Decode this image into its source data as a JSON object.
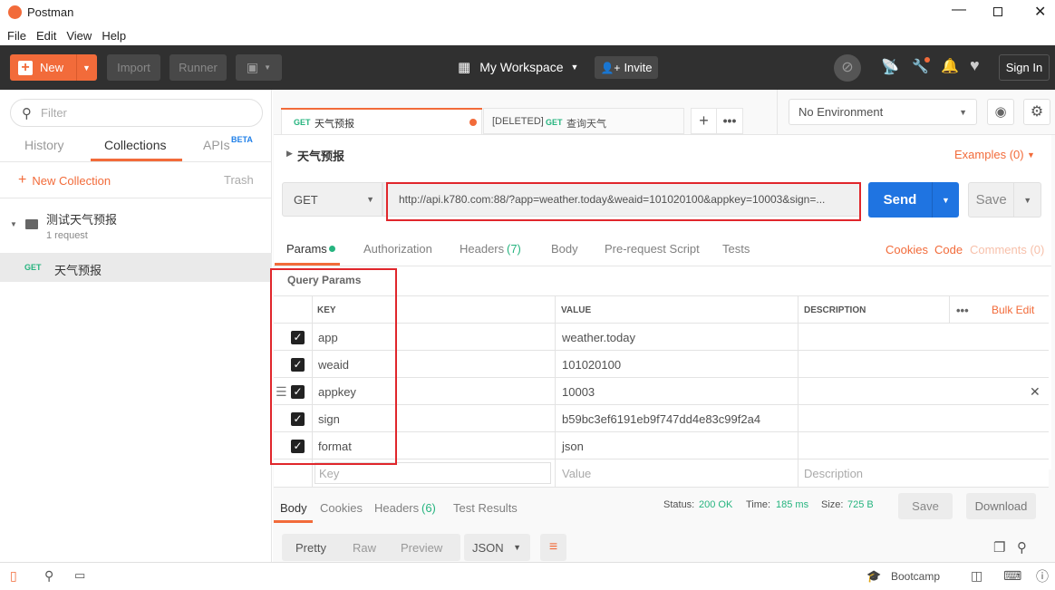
{
  "window": {
    "title": "Postman"
  },
  "menu": [
    "File",
    "Edit",
    "View",
    "Help"
  ],
  "toolbar": {
    "new": "New",
    "import": "Import",
    "runner": "Runner",
    "workspace": "My Workspace",
    "invite": "Invite",
    "signin": "Sign In"
  },
  "sidebar": {
    "filter_placeholder": "Filter",
    "tabs": {
      "history": "History",
      "collections": "Collections",
      "apis": "APIs",
      "beta": "BETA"
    },
    "new_collection": "New Collection",
    "trash": "Trash",
    "collection": {
      "name": "测试天气预报",
      "count": "1 request"
    },
    "request": {
      "method": "GET",
      "name": "天气预报"
    }
  },
  "tabs": [
    {
      "method": "GET",
      "name": "天气预报"
    },
    {
      "prefix": "[DELETED]",
      "method": "GET",
      "name": "查询天气"
    }
  ],
  "environment": "No Environment",
  "request": {
    "title": "天气预报",
    "examples": "Examples (0)",
    "method": "GET",
    "url": "http://api.k780.com:88/?app=weather.today&weaid=101020100&appkey=10003&sign=...",
    "send": "Send",
    "save": "Save"
  },
  "req_tabs": {
    "params": "Params",
    "authorization": "Authorization",
    "headers": "Headers",
    "headers_count": "(7)",
    "body": "Body",
    "prerequest": "Pre-request Script",
    "tests": "Tests",
    "cookies": "Cookies",
    "code": "Code",
    "comments": "Comments (0)"
  },
  "params": {
    "title": "Query Params",
    "headers": {
      "key": "KEY",
      "value": "VALUE",
      "description": "DESCRIPTION",
      "bulk_edit": "Bulk Edit"
    },
    "rows": [
      {
        "key": "app",
        "value": "weather.today"
      },
      {
        "key": "weaid",
        "value": "101020100"
      },
      {
        "key": "appkey",
        "value": "10003"
      },
      {
        "key": "sign",
        "value": "b59bc3ef6191eb9f747dd4e83c99f2a4"
      },
      {
        "key": "format",
        "value": "json"
      }
    ],
    "placeholders": {
      "key": "Key",
      "value": "Value",
      "description": "Description"
    }
  },
  "response": {
    "tabs": {
      "body": "Body",
      "cookies": "Cookies",
      "headers": "Headers",
      "headers_count": "(6)",
      "test_results": "Test Results"
    },
    "status_label": "Status:",
    "status": "200 OK",
    "time_label": "Time:",
    "time": "185 ms",
    "size_label": "Size:",
    "size": "725 B",
    "save": "Save",
    "download": "Download",
    "views": {
      "pretty": "Pretty",
      "raw": "Raw",
      "preview": "Preview",
      "format": "JSON"
    }
  },
  "statusbar": {
    "bootcamp": "Bootcamp"
  }
}
